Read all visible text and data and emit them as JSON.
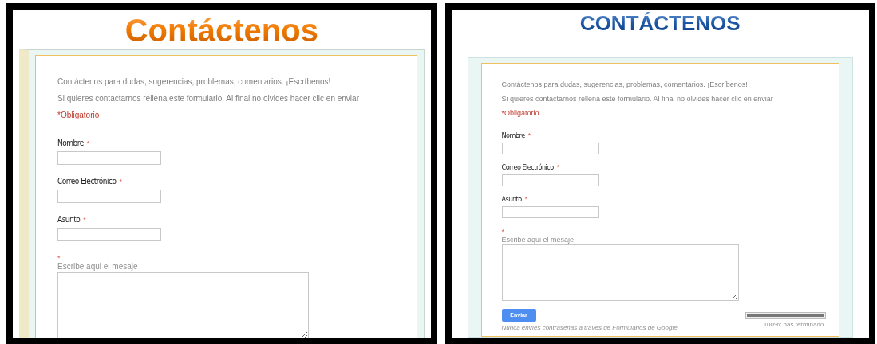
{
  "panels": [
    {
      "title": "Contáctenos",
      "kind": "orange",
      "description": [
        "Contáctenos para dudas, sugerencias, problemas, comentarios. ¡Escríbenos!",
        "Si quieres contactarnos rellena este formulario. Al final no olvides hacer clic en enviar"
      ],
      "required_note": "*Obligatorio",
      "fields": [
        {
          "kind": "text",
          "label": "Nombre",
          "required_mark": "*"
        },
        {
          "kind": "text",
          "label": "Correo Electrónico",
          "required_mark": "*"
        },
        {
          "kind": "text",
          "label": "Asunto",
          "required_mark": "*"
        },
        {
          "kind": "textarea",
          "required_mark": "*",
          "help": "Escribe aqui el mesaje"
        }
      ]
    },
    {
      "title": "CONTÁCTENOS",
      "kind": "blue",
      "description": [
        "Contáctenos para dudas, sugerencias, problemas, comentarios. ¡Escríbenos!",
        "Si quieres contactarnos rellena este formulario. Al final no olvides hacer clic en enviar"
      ],
      "required_note": "*Obligatorio",
      "fields": [
        {
          "kind": "text",
          "label": "Nombre",
          "required_mark": "*"
        },
        {
          "kind": "text",
          "label": "Correo Electrónico",
          "required_mark": "*"
        },
        {
          "kind": "text",
          "label": "Asunto",
          "required_mark": "*"
        },
        {
          "kind": "textarea",
          "required_mark": "*",
          "help": "Escribe aqui el mesaje"
        }
      ],
      "submit": "Enviar",
      "footer": "Nunca envíes contraseñas a través de Formularios de Google.",
      "progress": {
        "level": 1,
        "text": "100%: has terminado."
      }
    }
  ]
}
